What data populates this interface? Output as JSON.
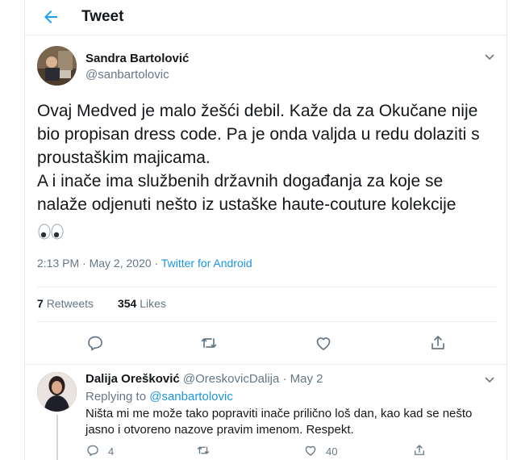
{
  "header": {
    "title": "Tweet",
    "back_icon": "arrow-left-icon"
  },
  "tweet": {
    "author_name": "Sandra Bartolović",
    "author_handle": "@sanbartolovic",
    "text": "Ovaj Medved je malo žešći debil. Kaže da za Okučane nije bio propisan dress code. Pa je onda valjda u redu dolaziti s proustaškim majicama.\nA i inače ima službenih državnih događanja za koje se nalaže odjenuti nešto iz ustaške haute-couture kolekcije",
    "emoji": "eyes-emoji",
    "time": "2:13 PM",
    "separator": "·",
    "date": "May 2, 2020",
    "source": "Twitter for Android",
    "retweets_count": "7",
    "retweets_label": "Retweets",
    "likes_count": "354",
    "likes_label": "Likes"
  },
  "reply": {
    "author_name": "Dalija Orešković",
    "author_handle": "@OreskovicDalija",
    "separator": "·",
    "date": "May 2",
    "replying_label": "Replying to",
    "replying_to": "@sanbartolovic",
    "text": "Ništa mi me može tako popraviti inače prilično loš dan, kao kad se nešto jasno i otvoreno nazove pravim imenom. Respekt.",
    "reply_count": "4",
    "like_count": "40"
  },
  "colors": {
    "accent": "#1b95e0",
    "muted": "#657786",
    "border": "#e6ecf0"
  }
}
